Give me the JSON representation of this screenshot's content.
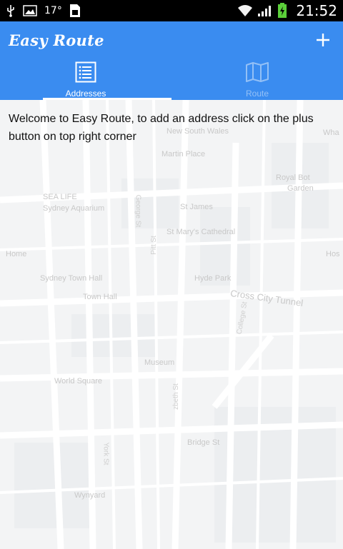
{
  "status_bar": {
    "temperature": "17°",
    "time": "21:52",
    "icons": [
      "usb-icon",
      "image-icon",
      "sim-icon",
      "wifi-icon",
      "signal-icon",
      "battery-charging-icon"
    ]
  },
  "app_bar": {
    "title": "Easy Route",
    "add_icon": "plus-icon",
    "background": "#3a8cf0"
  },
  "tabs": [
    {
      "label": "Addresses",
      "icon": "list-icon",
      "active": true
    },
    {
      "label": "Route",
      "icon": "map-icon",
      "active": false
    }
  ],
  "content": {
    "welcome_text": "Welcome to Easy Route, to add an address click on the plus button on top right corner"
  },
  "map": {
    "labels": {
      "new_south_wales": "New South Wales",
      "martin_place": "Martin Place",
      "royal_botanic": "Royal Bot",
      "garden": "Garden",
      "sea_life": "SEA LIFE",
      "sydney_aquarium": "Sydney Aquarium",
      "st_james": "St James",
      "st_marys": "St Mary's Cathedral",
      "sydney_town_hall": "Sydney Town Hall",
      "town_hall": "Town Hall",
      "hyde_park": "Hyde Park",
      "cross_city_tunnel": "Cross City Tunnel",
      "museum": "Museum",
      "world_square": "World Square",
      "bridge_st": "Bridge St",
      "wynyard": "Wynyard",
      "george_st": "George St",
      "pitt_st": "Pitt St",
      "york_st": "York St",
      "college_st": "College St",
      "elizabeth_st": "zbeth St",
      "home": "Home",
      "what": "Wha",
      "hos": "Hos"
    }
  }
}
